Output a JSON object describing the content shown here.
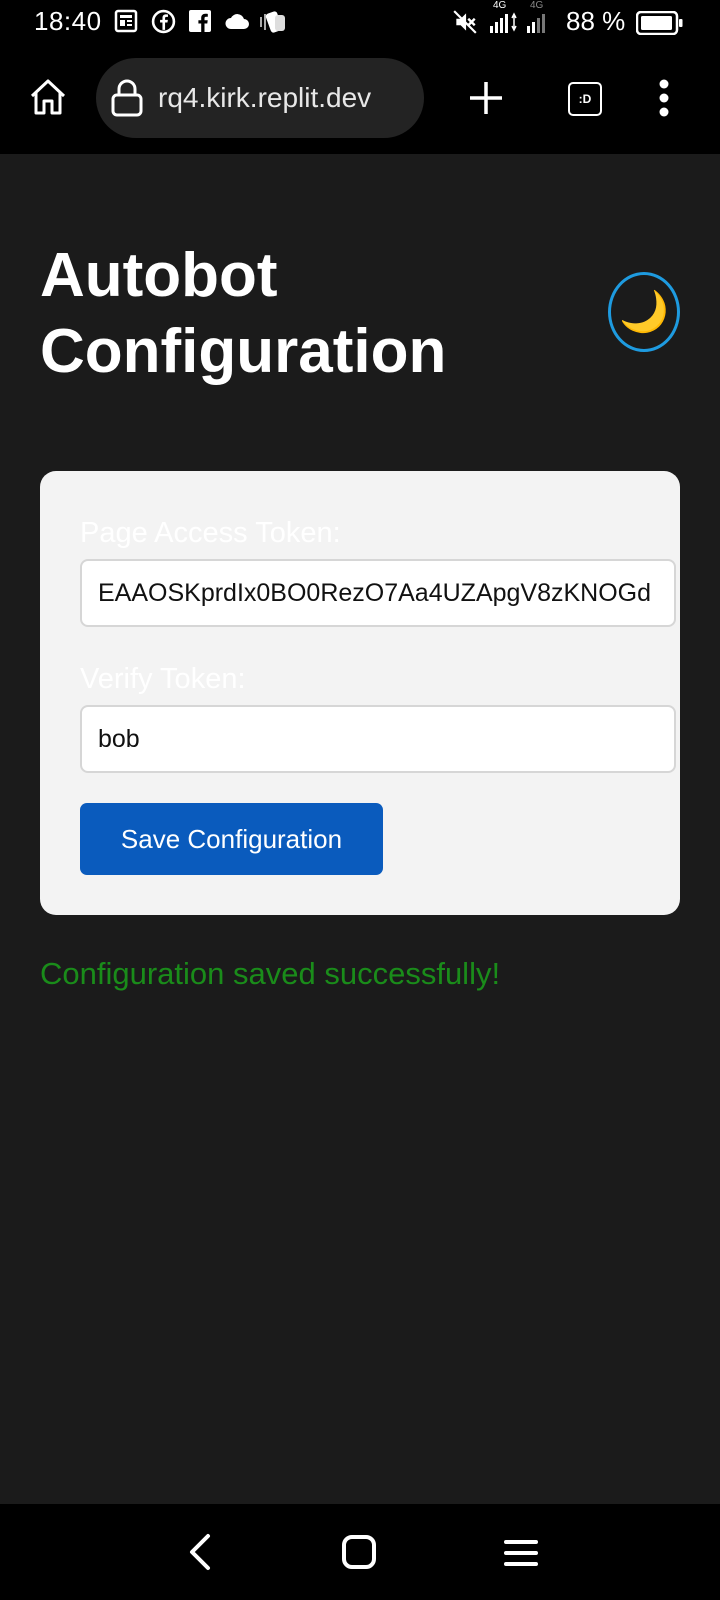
{
  "status_bar": {
    "time": "18:40",
    "battery_text": "88 %",
    "network_label_1": "4G",
    "network_label_2": "4G",
    "icons": [
      "news-icon",
      "facebook-circle-icon",
      "facebook-square-icon",
      "cloud-icon",
      "vibrate-icon",
      "mute-icon",
      "signal-icon",
      "signal-icon",
      "battery-icon"
    ]
  },
  "browser": {
    "url": "rq4.kirk.replit.dev",
    "tabs_label": ":D",
    "icons": [
      "home-icon",
      "lock-icon",
      "plus-icon",
      "tabs-icon",
      "more-vertical-icon"
    ]
  },
  "page": {
    "title": "Autobot Configuration",
    "theme_toggle_glyph": "🌙",
    "form": {
      "page_access_token_label": "Page Access Token:",
      "page_access_token_value": "EAAOSKprdIx0BO0RezO7Aa4UZApgV8zKNOGd",
      "verify_token_label": "Verify Token:",
      "verify_token_value": "bob",
      "save_button_label": "Save Configuration"
    },
    "success_message": "Configuration saved successfully!"
  },
  "nav": {
    "icons": [
      "back-icon",
      "home-square-icon",
      "recents-menu-icon"
    ]
  },
  "colors": {
    "background": "#1b1b1b",
    "card": "#f3f3f3",
    "primary_button": "#0a5bbd",
    "success": "#1a8c1a",
    "toggle_ring": "#1e9be0"
  }
}
